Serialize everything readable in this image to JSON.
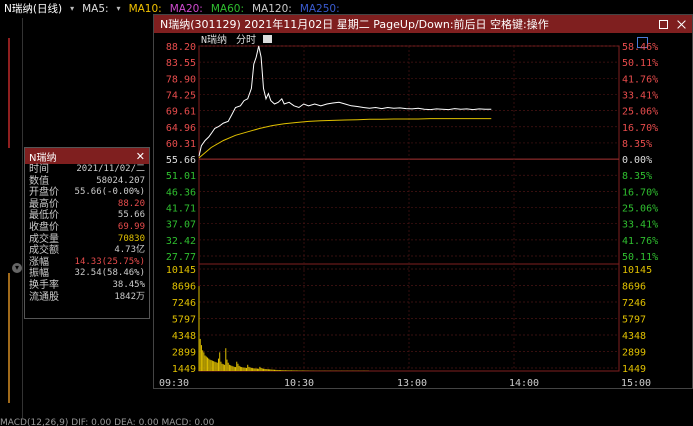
{
  "topbar": {
    "stock": "N瑞纳(日线)",
    "ma5": "MA5:",
    "ma10": "MA10:",
    "ma20": "MA20:",
    "ma60": "MA60:",
    "ma120": "MA120:",
    "ma250": "MA250:"
  },
  "popup": {
    "title": "N瑞纳(301129) 2021年11月02日 星期二 PageUp/Down:前后日 空格键:操作",
    "chart_label": "N瑞纳",
    "chart_sub": "分时"
  },
  "chart_data": {
    "type": "line",
    "xlabels": [
      "09:30",
      "10:30",
      "13:00",
      "14:00",
      "15:00"
    ],
    "price_ticks": [
      "88.20",
      "83.55",
      "78.90",
      "74.25",
      "69.61",
      "64.96",
      "60.31",
      "55.66",
      "51.01",
      "46.36",
      "41.71",
      "37.07",
      "32.42",
      "27.77"
    ],
    "pct_ticks": [
      "58.46%",
      "50.11%",
      "41.76%",
      "33.41%",
      "25.06%",
      "16.70%",
      "8.35%",
      "0.00%",
      "8.35%",
      "16.70%",
      "25.06%",
      "33.41%",
      "41.76%",
      "50.11%"
    ],
    "vol_ticks": [
      "10145",
      "8696",
      "7246",
      "5797",
      "4348",
      "2899",
      "1449"
    ],
    "prev_close": 55.66,
    "price_series": [
      [
        0,
        56.5
      ],
      [
        2,
        59.5
      ],
      [
        5,
        61
      ],
      [
        8,
        62
      ],
      [
        10,
        63
      ],
      [
        13,
        64.5
      ],
      [
        16,
        65
      ],
      [
        20,
        66
      ],
      [
        24,
        66.5
      ],
      [
        27,
        68.5
      ],
      [
        30,
        70.5
      ],
      [
        34,
        71
      ],
      [
        37,
        72.5
      ],
      [
        40,
        73
      ],
      [
        43,
        76
      ],
      [
        45,
        83
      ],
      [
        47,
        85
      ],
      [
        49,
        88.2
      ],
      [
        51,
        85
      ],
      [
        53,
        76
      ],
      [
        55,
        73
      ],
      [
        57,
        74.5
      ],
      [
        59,
        72.5
      ],
      [
        62,
        71.5
      ],
      [
        65,
        72
      ],
      [
        68,
        73
      ],
      [
        70,
        71.5
      ],
      [
        74,
        72
      ],
      [
        78,
        71
      ],
      [
        82,
        70.5
      ],
      [
        86,
        71.5
      ],
      [
        90,
        71
      ],
      [
        95,
        71.5
      ],
      [
        100,
        71
      ],
      [
        105,
        71.5
      ],
      [
        110,
        71.8
      ],
      [
        115,
        72
      ],
      [
        120,
        71.5
      ],
      [
        125,
        71
      ],
      [
        130,
        70.8
      ],
      [
        135,
        70.5
      ],
      [
        140,
        70.3
      ],
      [
        145,
        70.5
      ],
      [
        150,
        70.2
      ],
      [
        155,
        70.5
      ],
      [
        160,
        70.3
      ],
      [
        165,
        70.4
      ],
      [
        170,
        70.2
      ],
      [
        175,
        70.1
      ],
      [
        180,
        70.3
      ],
      [
        185,
        70.0
      ],
      [
        190,
        69.9
      ],
      [
        195,
        70.1
      ],
      [
        200,
        70.0
      ],
      [
        205,
        69.9
      ],
      [
        210,
        70.2
      ],
      [
        215,
        70.0
      ],
      [
        220,
        70.1
      ],
      [
        225,
        69.9
      ],
      [
        230,
        70.1
      ],
      [
        235,
        70.0
      ],
      [
        240,
        69.99
      ]
    ],
    "avg_series": [
      [
        0,
        56
      ],
      [
        10,
        59
      ],
      [
        20,
        61
      ],
      [
        30,
        62.5
      ],
      [
        40,
        63.5
      ],
      [
        50,
        64.5
      ],
      [
        60,
        65.3
      ],
      [
        70,
        65.8
      ],
      [
        80,
        66.2
      ],
      [
        90,
        66.5
      ],
      [
        100,
        66.7
      ],
      [
        110,
        66.8
      ],
      [
        120,
        66.9
      ],
      [
        130,
        67.0
      ],
      [
        140,
        67.1
      ],
      [
        150,
        67.1
      ],
      [
        160,
        67.2
      ],
      [
        170,
        67.2
      ],
      [
        180,
        67.2
      ],
      [
        190,
        67.3
      ],
      [
        200,
        67.3
      ],
      [
        210,
        67.3
      ],
      [
        220,
        67.3
      ],
      [
        230,
        67.3
      ],
      [
        240,
        67.3
      ]
    ],
    "volume": [
      8200,
      3100,
      2500,
      2000,
      1800,
      1500,
      1400,
      1300,
      1200,
      1100,
      1050,
      1000,
      950,
      900,
      850,
      800,
      1200,
      1800,
      900,
      700,
      650,
      600,
      2200,
      1100,
      800,
      600,
      550,
      500,
      450,
      400,
      380,
      900,
      700,
      500,
      420,
      380,
      350,
      330,
      320,
      300,
      600,
      400,
      350,
      300,
      280,
      260,
      250,
      240,
      230,
      220,
      400,
      300,
      250,
      220,
      200,
      190,
      180,
      170,
      160,
      150,
      140,
      130,
      120,
      110,
      100,
      95,
      90,
      85,
      80,
      75,
      70,
      68,
      66,
      64,
      62,
      60,
      58,
      56,
      54,
      52,
      50,
      48,
      46,
      44,
      42,
      40,
      38,
      36,
      34,
      32,
      30,
      28,
      26,
      24,
      22,
      20,
      20,
      20,
      20,
      20,
      20,
      20,
      20,
      20,
      20,
      20,
      20,
      20,
      20,
      20,
      20,
      20,
      20,
      20,
      20,
      20,
      20,
      20,
      20,
      20,
      20,
      20,
      20,
      20,
      20,
      20,
      20,
      20,
      20,
      20,
      20,
      20,
      20,
      20,
      20,
      20,
      20,
      20,
      20,
      20
    ],
    "ylim": [
      27.77,
      88.2
    ],
    "vol_max": 10145
  },
  "info": {
    "title": "N瑞纳",
    "rows": [
      {
        "k": "时间",
        "v": "2021/11/02/二",
        "c": "#ccc"
      },
      {
        "k": "数值",
        "v": "58024.207",
        "c": "#ccc"
      },
      {
        "k": "开盘价",
        "v": "55.66(-0.00%)",
        "c": "#ccc"
      },
      {
        "k": "最高价",
        "v": "88.20",
        "c": "#e74c4c"
      },
      {
        "k": "最低价",
        "v": "55.66",
        "c": "#ccc"
      },
      {
        "k": "收盘价",
        "v": "69.99",
        "c": "#e74c4c"
      },
      {
        "k": "成交量",
        "v": "70830",
        "c": "#e0c000"
      },
      {
        "k": "成交额",
        "v": "4.73亿",
        "c": "#ccc"
      },
      {
        "k": "涨幅",
        "v": "14.33(25.75%)",
        "c": "#e74c4c"
      },
      {
        "k": "振幅",
        "v": "32.54(58.46%)",
        "c": "#ccc"
      },
      {
        "k": "换手率",
        "v": "38.45%",
        "c": "#ccc"
      },
      {
        "k": "流通股",
        "v": "1842万",
        "c": "#ccc"
      }
    ]
  },
  "bottom": {
    "text": "MACD(12,26,9) DIF: 0.00 DEA: 0.00 MACD: 0.00"
  }
}
